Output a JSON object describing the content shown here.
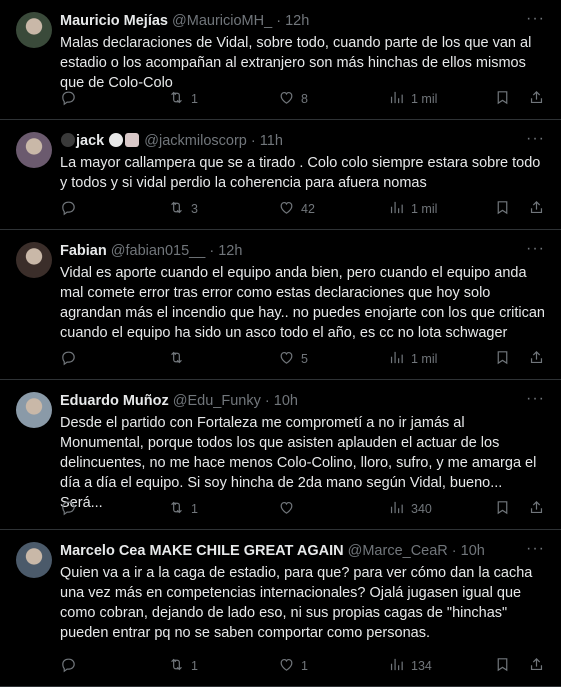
{
  "tweets": [
    {
      "name": "Mauricio Mejías",
      "handle": "@MauricioMH_",
      "time": "12h",
      "text": "Malas declaraciones de Vidal, sobre todo, cuando parte de los que van al estadio o los acompañan al extranjero son más hinchas de ellos mismos que de Colo-Colo",
      "replies": "",
      "retweets": "1",
      "likes": "8",
      "views": "1 mil",
      "avatar_color": "#3a4a3a"
    },
    {
      "name": "jack",
      "handle": "@jackmiloscorp",
      "time": "11h",
      "text": "La mayor callampera que se a tirado . Colo colo siempre estara sobre todo y todos y si vidal perdio la coherencia  para afuera nomas",
      "replies": "",
      "retweets": "3",
      "likes": "42",
      "views": "1 mil",
      "avatar_color": "#6b5a6e"
    },
    {
      "name": "Fabian",
      "handle": "@fabian015__",
      "time": "12h",
      "text": "Vidal es aporte cuando el equipo anda bien, pero cuando el equipo anda mal comete error tras error como estas declaraciones que hoy solo agrandan más el incendio que hay.. no puedes enojarte con los que critican cuando el equipo ha sido un asco todo el año, es cc no lota schwager",
      "replies": "",
      "retweets": "",
      "likes": "5",
      "views": "1 mil",
      "avatar_color": "#3b2e2a"
    },
    {
      "name": "Eduardo Muñoz",
      "handle": "@Edu_Funky",
      "time": "10h",
      "text": "Desde el partido con Fortaleza me comprometí a no ir jamás al Monumental, porque todos los que asisten aplauden el actuar de los delincuentes, no me hace menos Colo-Colino, lloro, sufro, y me amarga el día a día el equipo. Si soy hincha de 2da mano según Vidal, bueno... Será...",
      "replies": "",
      "retweets": "1",
      "likes": "",
      "views": "340",
      "avatar_color": "#8a9aa8"
    },
    {
      "name": "Marcelo Cea MAKE CHILE GREAT AGAIN",
      "handle": "@Marce_CeaR",
      "time": "10h",
      "text": "Quien va a ir a la caga de estadio, para que? para ver cómo dan la cacha una vez más en competencias internacionales? Ojalá jugasen igual que como cobran, dejando de lado eso, ni sus propias cagas de \"hinchas\" pueden entrar pq no se saben comportar como personas.",
      "replies": "",
      "retweets": "1",
      "likes": "1",
      "views": "134",
      "avatar_color": "#4b5a6a"
    }
  ],
  "separator": "·",
  "more_icon": "more-icon",
  "reply_icon": "reply-icon",
  "retweet_icon": "retweet-icon",
  "like_icon": "heart-icon",
  "views_icon": "views-icon",
  "share_icon": "share-icon"
}
